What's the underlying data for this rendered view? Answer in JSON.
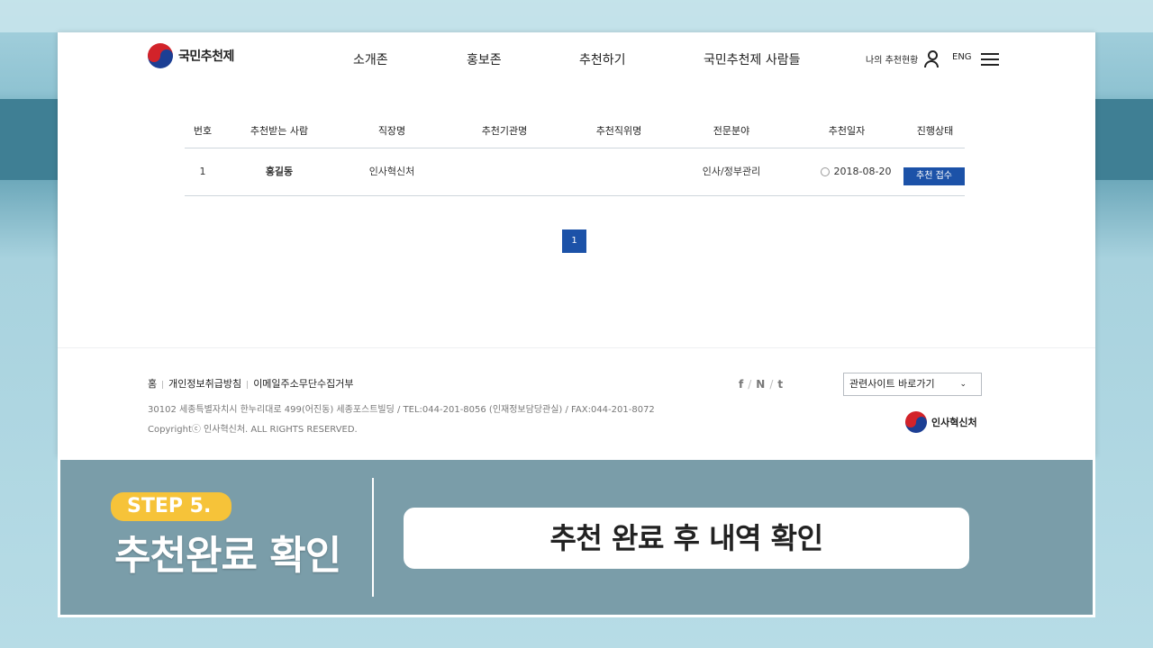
{
  "header": {
    "logo_text": "국민추천제",
    "nav": [
      "소개존",
      "홍보존",
      "추천하기",
      "국민추천제 사람들"
    ],
    "my_status": "나의 추천현황",
    "lang": "ENG"
  },
  "table": {
    "headers": [
      "번호",
      "추천받는 사람",
      "직장명",
      "추천기관명",
      "추천직위명",
      "전문분야",
      "추천일자",
      "진행상태"
    ],
    "rows": [
      {
        "no": "1",
        "name": "홍길동",
        "workplace": "인사혁신처",
        "org": "",
        "position": "",
        "field": "인사/정부관리",
        "date": "2018-08-20",
        "status": "추천 접수"
      }
    ]
  },
  "pagination": {
    "current": "1"
  },
  "footer": {
    "links": [
      "홈",
      "개인정보취급방침",
      "이메일주소무단수집거부"
    ],
    "address": "30102 세종특별자치시 한누리대로 499(어진동) 세종포스트빌딩 / TEL:044-201-8056 (인재정보담당관실) / FAX:044-201-8072",
    "copyright": "Copyrightⓒ 인사혁신처. ALL RIGHTS RESERVED.",
    "social": [
      "f",
      "N",
      "t"
    ],
    "related_sites": "관련사이트 바로가기",
    "org_name": "인사혁신처"
  },
  "banner": {
    "step": "STEP 5.",
    "title": "추천완료 확인",
    "caption": "추천 완료 후 내역 확인"
  },
  "colors": {
    "primary_blue": "#1c52a8",
    "step_yellow": "#f6c339",
    "banner_bg": "#789aa7"
  }
}
